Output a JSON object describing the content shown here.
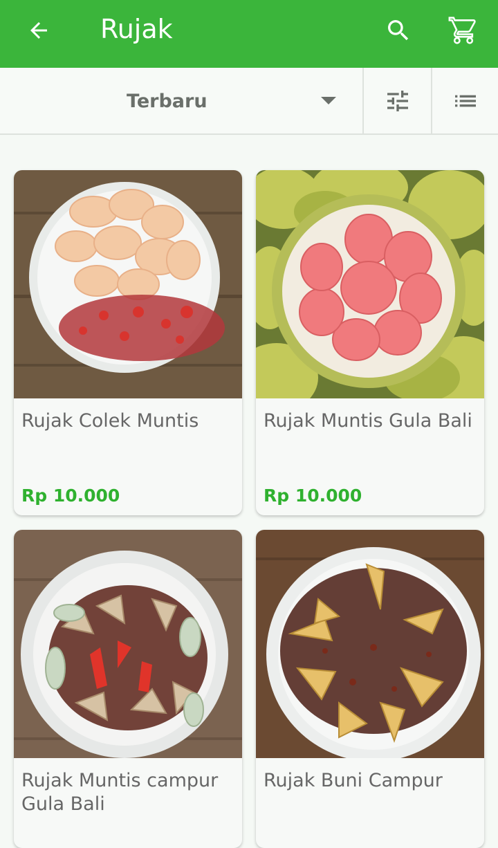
{
  "appbar": {
    "title": "Rujak",
    "back_icon": "arrow-left-icon",
    "search_icon": "search-icon",
    "cart_icon": "cart-icon",
    "background": "#3bb53b"
  },
  "toolbar": {
    "sort_label": "Terbaru",
    "sort_icon": "caret-down-icon",
    "filter_icon": "sliders-icon",
    "view_icon": "list-view-icon"
  },
  "products": [
    {
      "name": "Rujak Colek Muntis",
      "price": "Rp 10.000"
    },
    {
      "name": "Rujak Muntis Gula Bali",
      "price": "Rp 10.000"
    },
    {
      "name": "Rujak Muntis campur Gula Bali",
      "price": ""
    },
    {
      "name": "Rujak Buni Campur",
      "price": ""
    }
  ],
  "colors": {
    "accent": "#3bb53b",
    "price": "#2fb12f"
  }
}
